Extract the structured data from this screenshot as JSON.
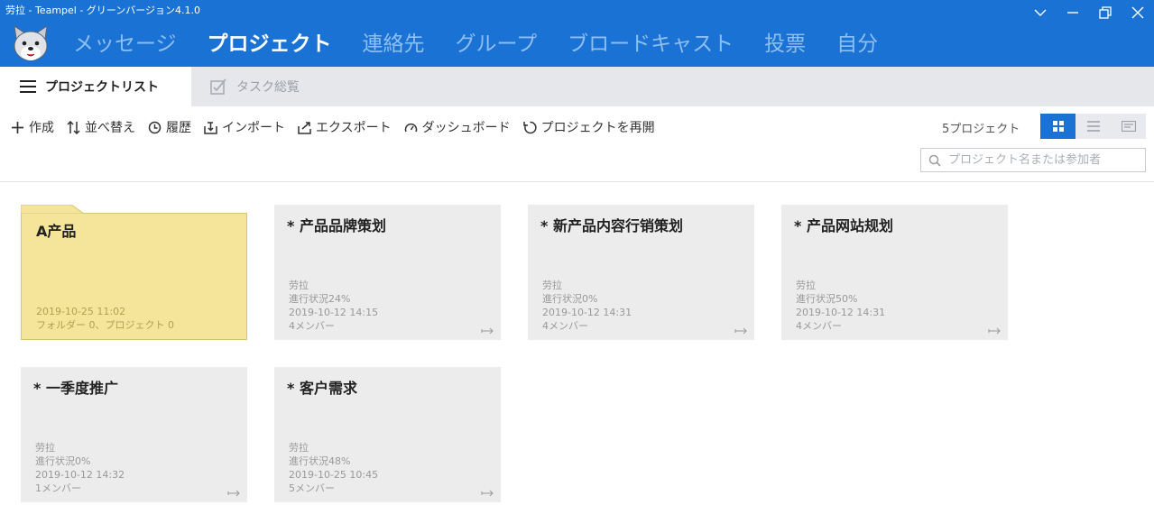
{
  "window": {
    "title": "劳拉 - Teampel - グリーンバージョン4.1.0"
  },
  "nav": {
    "items": [
      {
        "label": "メッセージ",
        "active": false
      },
      {
        "label": "プロジェクト",
        "active": true
      },
      {
        "label": "連絡先",
        "active": false
      },
      {
        "label": "グループ",
        "active": false
      },
      {
        "label": "ブロードキャスト",
        "active": false
      },
      {
        "label": "投票",
        "active": false
      },
      {
        "label": "自分",
        "active": false
      }
    ]
  },
  "subtabs": {
    "project_list": "プロジェクトリスト",
    "task_overview": "タスク総覧"
  },
  "toolbar": {
    "create": "作成",
    "sort": "並べ替え",
    "history": "履歴",
    "import": "インポート",
    "export": "エクスポート",
    "dashboard": "ダッシュボード",
    "reopen": "プロジェクトを再開"
  },
  "project_count": "5プロジェクト",
  "search": {
    "placeholder": "プロジェクト名または参加者"
  },
  "folder": {
    "title": "A产品",
    "date": "2019-10-25 11:02",
    "summary": "フォルダー 0、プロジェクト 0"
  },
  "projects": [
    {
      "title": "* 产品品牌策划",
      "owner": "劳拉",
      "progress": "進行状況24%",
      "date": "2019-10-12 14:15",
      "members": "4メンバー"
    },
    {
      "title": "* 新产品内容行销策划",
      "owner": "劳拉",
      "progress": "進行状況0%",
      "date": "2019-10-12 14:31",
      "members": "4メンバー"
    },
    {
      "title": "* 产品网站规划",
      "owner": "劳拉",
      "progress": "進行状況50%",
      "date": "2019-10-12 14:31",
      "members": "4メンバー"
    },
    {
      "title": "* 一季度推广",
      "owner": "劳拉",
      "progress": "進行状況0%",
      "date": "2019-10-12 14:32",
      "members": "1メンバー"
    },
    {
      "title": "* 客户需求",
      "owner": "劳拉",
      "progress": "進行状況48%",
      "date": "2019-10-25 10:45",
      "members": "5メンバー"
    }
  ],
  "colors": {
    "primary": "#1a73d4",
    "folder": "#f5e59a",
    "card": "#ececec"
  }
}
